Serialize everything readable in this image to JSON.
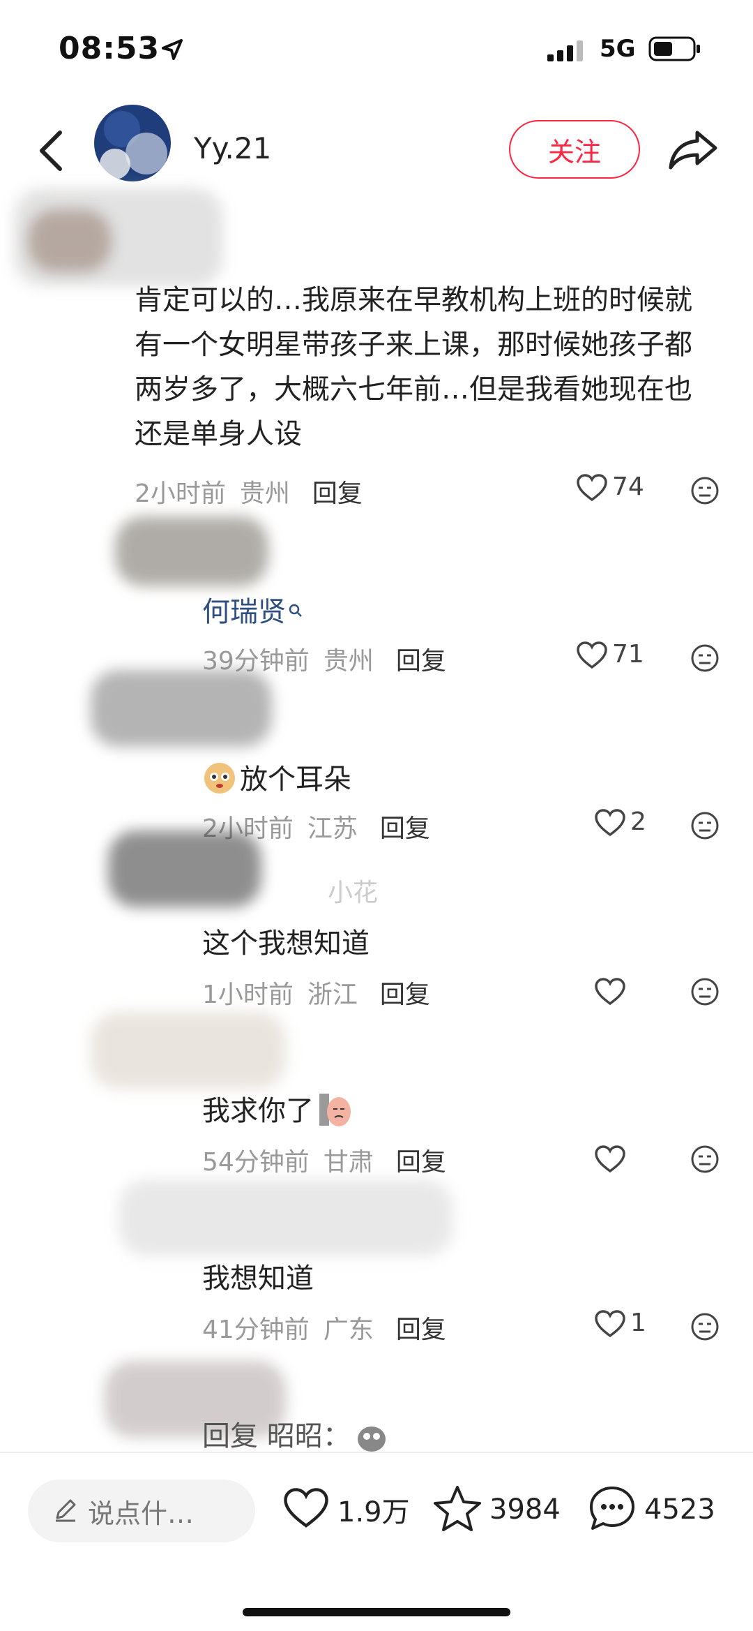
{
  "status_bar": {
    "time": "08:53",
    "network": "5G"
  },
  "header": {
    "username": "Yy.21",
    "follow_label": "关注"
  },
  "comments": [
    {
      "text": "肯定可以的…我原来在早教机构上班的时候就有一个女明星带孩子来上课，那时候她孩子都两岁多了，大概六七年前…但是我看她现在也还是单身人设",
      "time": "2小时前",
      "location": "贵州",
      "reply": "回复",
      "likes": "74"
    },
    {
      "text": "何瑞贤",
      "time": "39分钟前",
      "location": "贵州",
      "reply": "回复",
      "likes": "71"
    },
    {
      "text": "放个耳朵",
      "time": "2小时前",
      "location": "江苏",
      "reply": "回复",
      "likes": "2"
    },
    {
      "author_partial": "小花",
      "text": "这个我想知道",
      "time": "1小时前",
      "location": "浙江",
      "reply": "回复",
      "likes": ""
    },
    {
      "text": "我求你了",
      "time": "54分钟前",
      "location": "甘肃",
      "reply": "回复",
      "likes": ""
    },
    {
      "text": "我想知道",
      "time": "41分钟前",
      "location": "广东",
      "reply": "回复",
      "likes": "1"
    },
    {
      "text": "回复 昭昭："
    }
  ],
  "bottom_bar": {
    "input_placeholder": "说点什…",
    "likes": "1.9万",
    "favorites": "3984",
    "comments": "4523"
  },
  "colors": {
    "accent": "#ff2442",
    "text": "#222222",
    "meta": "#999999"
  }
}
